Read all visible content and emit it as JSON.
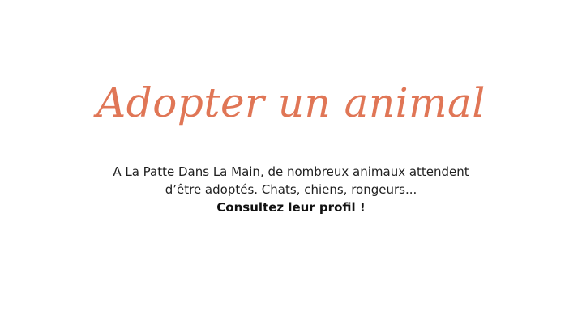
{
  "section": {
    "title": "Adopter un animal",
    "text_line_1": "A La Patte Dans La Main, de nombreux animaux attendent",
    "text_line_2": "d’être adoptés. Chats, chiens, rongeurs...",
    "cta": "Consultez leur profil !"
  },
  "colors": {
    "title": "#e07656",
    "text": "#1f1f1f",
    "background": "#ffffff"
  }
}
